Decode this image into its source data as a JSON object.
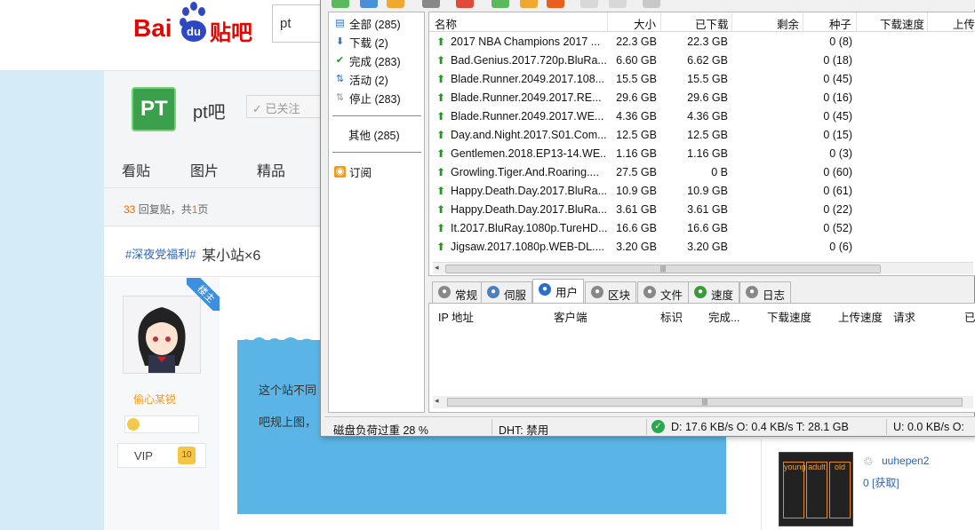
{
  "forum": {
    "logo_text": "Bai",
    "logo_du": "du",
    "logo_tieba": "贴吧",
    "search_value": "pt",
    "forum_logo": "PT",
    "forum_name": "pt吧",
    "follow_label": "✓ 已关注",
    "nav": [
      "看贴",
      "图片",
      "精品"
    ],
    "reply_count": "33",
    "reply_text_a": " 回复贴，共",
    "page_count": "1",
    "reply_text_b": "页",
    "post_tag": "#深夜党福利#",
    "post_title": "某小站×6",
    "louzhu": "楼主",
    "username": "偷心某锐",
    "vip_label": "VIP",
    "vip_level": "10",
    "post_line1": "这个站不同",
    "post_line2": "吧规上图，",
    "right_user": "uuhepen2",
    "right_get": "0 [获取]",
    "thumb_labels": [
      "young",
      "adult",
      "old"
    ]
  },
  "client": {
    "categories": [
      {
        "label": "全部 (285)",
        "icon": "all-icon"
      },
      {
        "label": "下载 (2)",
        "icon": "download-icon"
      },
      {
        "label": "完成 (283)",
        "icon": "check-icon"
      },
      {
        "label": "活动 (2)",
        "icon": "active-icon"
      },
      {
        "label": "停止 (283)",
        "icon": "stopped-icon"
      }
    ],
    "other": "其他 (285)",
    "rss": "订阅",
    "columns": {
      "name": "名称",
      "size": "大小",
      "downloaded": "已下载",
      "remaining": "剩余",
      "seeds": "种子",
      "down_speed": "下载速度",
      "up_speed": "上传速"
    },
    "torrents": [
      {
        "name": "2017 NBA Champions 2017 ...",
        "size": "22.3 GB",
        "downloaded": "22.3 GB",
        "seeds": "0 (8)"
      },
      {
        "name": "Bad.Genius.2017.720p.BluRa...",
        "size": "6.60 GB",
        "downloaded": "6.62 GB",
        "seeds": "0 (18)"
      },
      {
        "name": "Blade.Runner.2049.2017.108...",
        "size": "15.5 GB",
        "downloaded": "15.5 GB",
        "seeds": "0 (45)"
      },
      {
        "name": "Blade.Runner.2049.2017.RE...",
        "size": "29.6 GB",
        "downloaded": "29.6 GB",
        "seeds": "0 (16)"
      },
      {
        "name": "Blade.Runner.2049.2017.WE...",
        "size": "4.36 GB",
        "downloaded": "4.36 GB",
        "seeds": "0 (45)"
      },
      {
        "name": "Day.and.Night.2017.S01.Com...",
        "size": "12.5 GB",
        "downloaded": "12.5 GB",
        "seeds": "0 (15)"
      },
      {
        "name": "Gentlemen.2018.EP13-14.WE...",
        "size": "1.16 GB",
        "downloaded": "1.16 GB",
        "seeds": "0 (3)"
      },
      {
        "name": "Growling.Tiger.And.Roaring....",
        "size": "27.5 GB",
        "downloaded": "0 B",
        "seeds": "0 (60)"
      },
      {
        "name": "Happy.Death.Day.2017.BluRa...",
        "size": "10.9 GB",
        "downloaded": "10.9 GB",
        "seeds": "0 (61)"
      },
      {
        "name": "Happy.Death.Day.2017.BluRa...",
        "size": "3.61 GB",
        "downloaded": "3.61 GB",
        "seeds": "0 (22)"
      },
      {
        "name": "It.2017.BluRay.1080p.TureHD...",
        "size": "16.6 GB",
        "downloaded": "16.6 GB",
        "seeds": "0 (52)"
      },
      {
        "name": "Jigsaw.2017.1080p.WEB-DL....",
        "size": "3.20 GB",
        "downloaded": "3.20 GB",
        "seeds": "0 (6)"
      }
    ],
    "tabs": [
      {
        "label": "常规",
        "icon": "info-icon"
      },
      {
        "label": "伺服",
        "icon": "server-icon"
      },
      {
        "label": "用户",
        "icon": "users-icon"
      },
      {
        "label": "区块",
        "icon": "pieces-icon"
      },
      {
        "label": "文件",
        "icon": "files-icon"
      },
      {
        "label": "速度",
        "icon": "speed-icon"
      },
      {
        "label": "日志",
        "icon": "log-icon"
      }
    ],
    "peer_columns": {
      "ip": "IP 地址",
      "client": "客户端",
      "flags": "标识",
      "done": "完成...",
      "down": "下载速度",
      "up": "上传速度",
      "req": "请求",
      "already": "已"
    },
    "status": {
      "disk": "磁盘负荷过重 28 %",
      "dht": "DHT: 禁用",
      "down": "D: 17.6 KB/s O: 0.4 KB/s T: 28.1 GB",
      "up": "U: 0.0 KB/s O:"
    }
  }
}
